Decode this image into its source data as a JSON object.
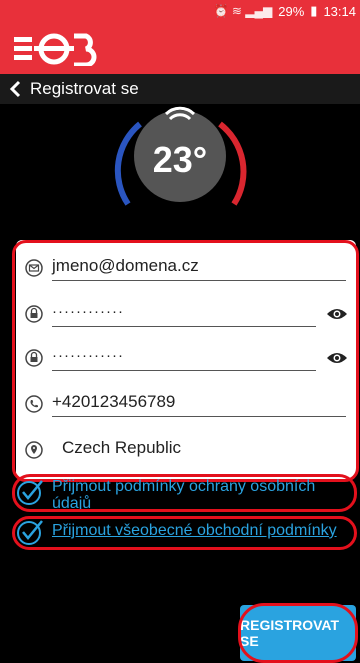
{
  "status_bar": {
    "battery": "29%",
    "time": "13:14"
  },
  "header": {
    "title": "Registrovat se"
  },
  "thermostat": {
    "temperature": "23°"
  },
  "form": {
    "email": "jmeno@domena.cz",
    "password": "············",
    "password_confirm": "············",
    "phone": "+420123456789",
    "country": "Czech Republic"
  },
  "consents": {
    "privacy_label": "Přijmout podmínky ochrany osobních údajů",
    "terms_label": "Přijmout všeobecné obchodní podmínky"
  },
  "actions": {
    "register_label": "REGISTROVAT SE"
  },
  "colors": {
    "brand_red": "#e8303a",
    "outline_red": "#e3101c",
    "accent_blue": "#2aa3e0"
  }
}
